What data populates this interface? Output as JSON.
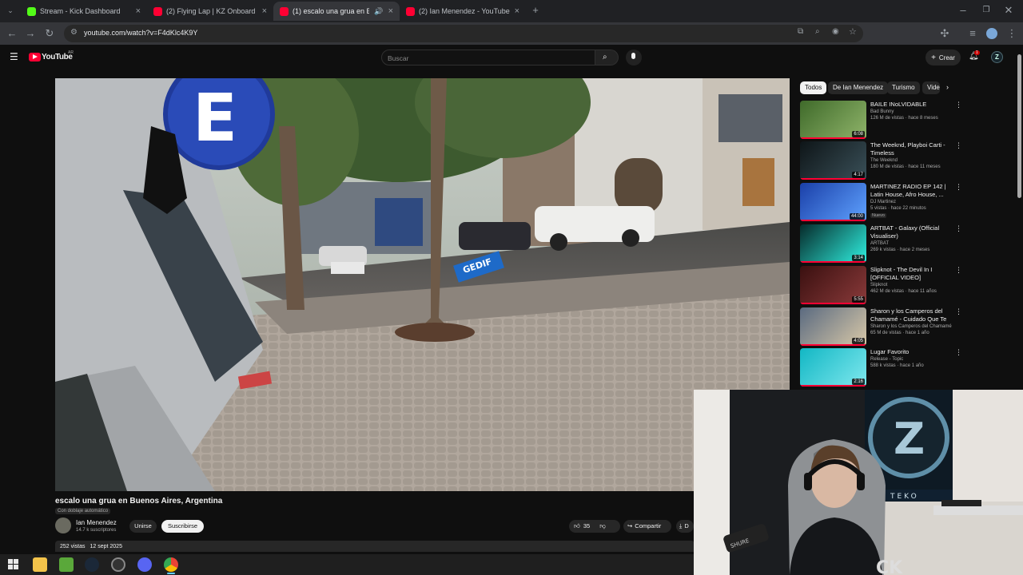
{
  "browser": {
    "tabs": [
      {
        "title": "Stream - Kick Dashboard",
        "icon": "kick-icon",
        "active": false
      },
      {
        "title": "(2) Flying Lap | KZ Onboard at",
        "icon": "youtube-icon",
        "active": false
      },
      {
        "title": "(1) escalo una grua en Buen",
        "icon": "youtube-icon",
        "active": true
      },
      {
        "title": "(2) Ian Menendez - YouTube",
        "icon": "youtube-icon",
        "active": false
      }
    ],
    "url": "youtube.com/watch?v=F4dKlc4K9Y"
  },
  "youtube": {
    "logo_text": "YouTube",
    "region": "AR",
    "search_placeholder": "Buscar",
    "create_label": "Crear",
    "notification_count": "1",
    "account_initial": "Z"
  },
  "video": {
    "title": "escalo una grua en Buenos Aires, Argentina",
    "dub_label": "Con doblaje automático",
    "channel": "Ian Menendez",
    "subscribers": "14.7 k suscriptores",
    "join_label": "Unirse",
    "subscribe_label": "Suscribirse",
    "likes": "35",
    "share_label": "Compartir",
    "download_label": "D",
    "views": "252 vistas",
    "date": "12 sept 2025",
    "street_sign_letter": "E",
    "barrier_sign": "GEDIF"
  },
  "chips": [
    "Todos",
    "De Ian Menendez",
    "Turismo",
    "Vide"
  ],
  "recommendations": [
    {
      "title": "BAILE INoLVIDABLE",
      "channel": "Bad Bunny",
      "meta": "126 M de vistas · hace 8 meses",
      "duration": "6:08",
      "badge": "",
      "colors": [
        "#3f6a2a",
        "#8fb46a"
      ]
    },
    {
      "title": "The Weeknd, Playboi Carti - Timeless",
      "channel": "The Weeknd",
      "meta": "180 M de vistas · hace 11 meses",
      "duration": "4:17",
      "badge": "",
      "colors": [
        "#0e1518",
        "#3a5058"
      ]
    },
    {
      "title": "MARTINEZ RADIO EP 142 | Latin House, Afro House, ...",
      "channel": "DJ Martinez",
      "meta": "5 vistas · hace 22 minutos",
      "duration": "44:00",
      "badge": "Nuevo",
      "colors": [
        "#1a3fa8",
        "#5fa2ff"
      ]
    },
    {
      "title": "ARTBAT - Galaxy (Official Visualiser)",
      "channel": "ARTBAT",
      "meta": "269 k vistas · hace 2 meses",
      "duration": "3:14",
      "badge": "",
      "colors": [
        "#062a2a",
        "#2ff0e0"
      ]
    },
    {
      "title": "Slipknot - The Devil In I [OFFICIAL VIDEO]",
      "channel": "Slipknot",
      "meta": "462 M de vistas · hace 11 años",
      "duration": "5:55",
      "badge": "",
      "colors": [
        "#3a1010",
        "#8a3a3a"
      ]
    },
    {
      "title": "Sharon y los Camperos del Chamamé - Cuidado Que Te ...",
      "channel": "Sharon y los Camperos del Chamamé",
      "meta": "65 M de vistas · hace 1 año",
      "duration": "4:05",
      "badge": "",
      "colors": [
        "#5a6a80",
        "#d8c8a8"
      ]
    },
    {
      "title": "Lugar Favorito",
      "channel": "Release - Topic",
      "meta": "588 k vistas · hace 1 año",
      "duration": "2:16",
      "badge": "",
      "colors": [
        "#12b7c4",
        "#7fe8ee"
      ]
    }
  ],
  "webcam": {
    "logo_letter": "Z",
    "shelf_text": "TEKO",
    "mic_text": "SHURE",
    "shirt_text": "CK"
  }
}
